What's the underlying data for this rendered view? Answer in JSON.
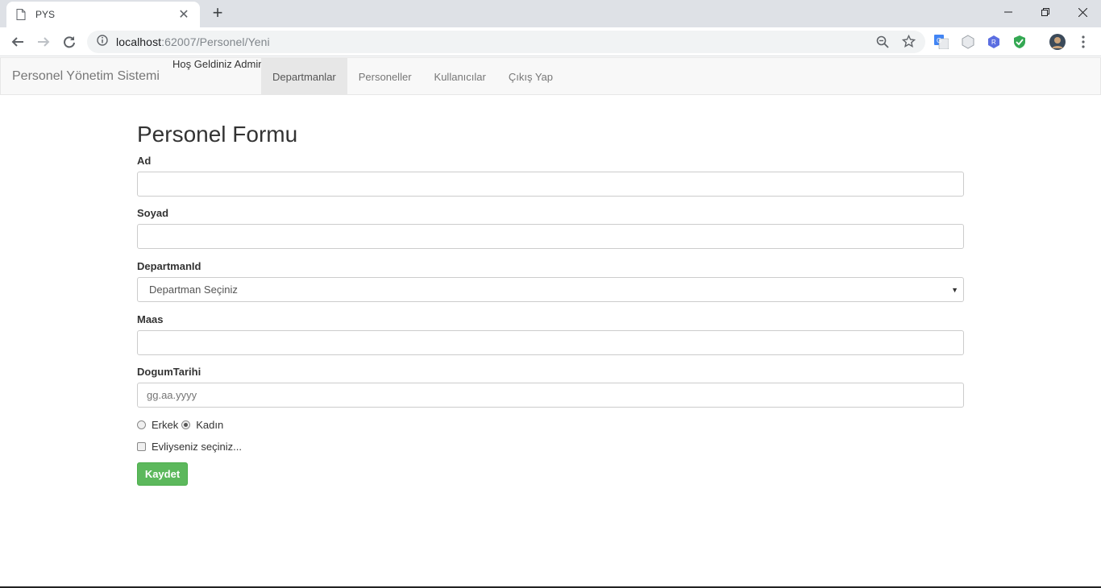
{
  "browser": {
    "tab_title": "PYS",
    "url_host": "localhost",
    "url_path": ":62007/Personel/Yeni"
  },
  "navbar": {
    "brand": "Personel Yönetim Sistemi",
    "welcome": "Hoş Geldiniz Admin",
    "links": [
      {
        "label": "Departmanlar",
        "active": true
      },
      {
        "label": "Personeller",
        "active": false
      },
      {
        "label": "Kullanıcılar",
        "active": false
      },
      {
        "label": "Çıkış Yap",
        "active": false
      }
    ]
  },
  "form": {
    "title": "Personel Formu",
    "ad_label": "Ad",
    "ad_value": "",
    "soyad_label": "Soyad",
    "soyad_value": "",
    "departman_label": "DepartmanId",
    "departman_selected": "Departman Seçiniz",
    "maas_label": "Maas",
    "maas_value": "",
    "dogum_label": "DogumTarihi",
    "dogum_placeholder": "gg.aa.yyyy",
    "gender_erkek": "Erkek",
    "gender_kadin": "Kadın",
    "gender_selected": "Kadın",
    "evli_label": "Evliyseniz seçiniz...",
    "evli_checked": false,
    "save_label": "Kaydet"
  }
}
